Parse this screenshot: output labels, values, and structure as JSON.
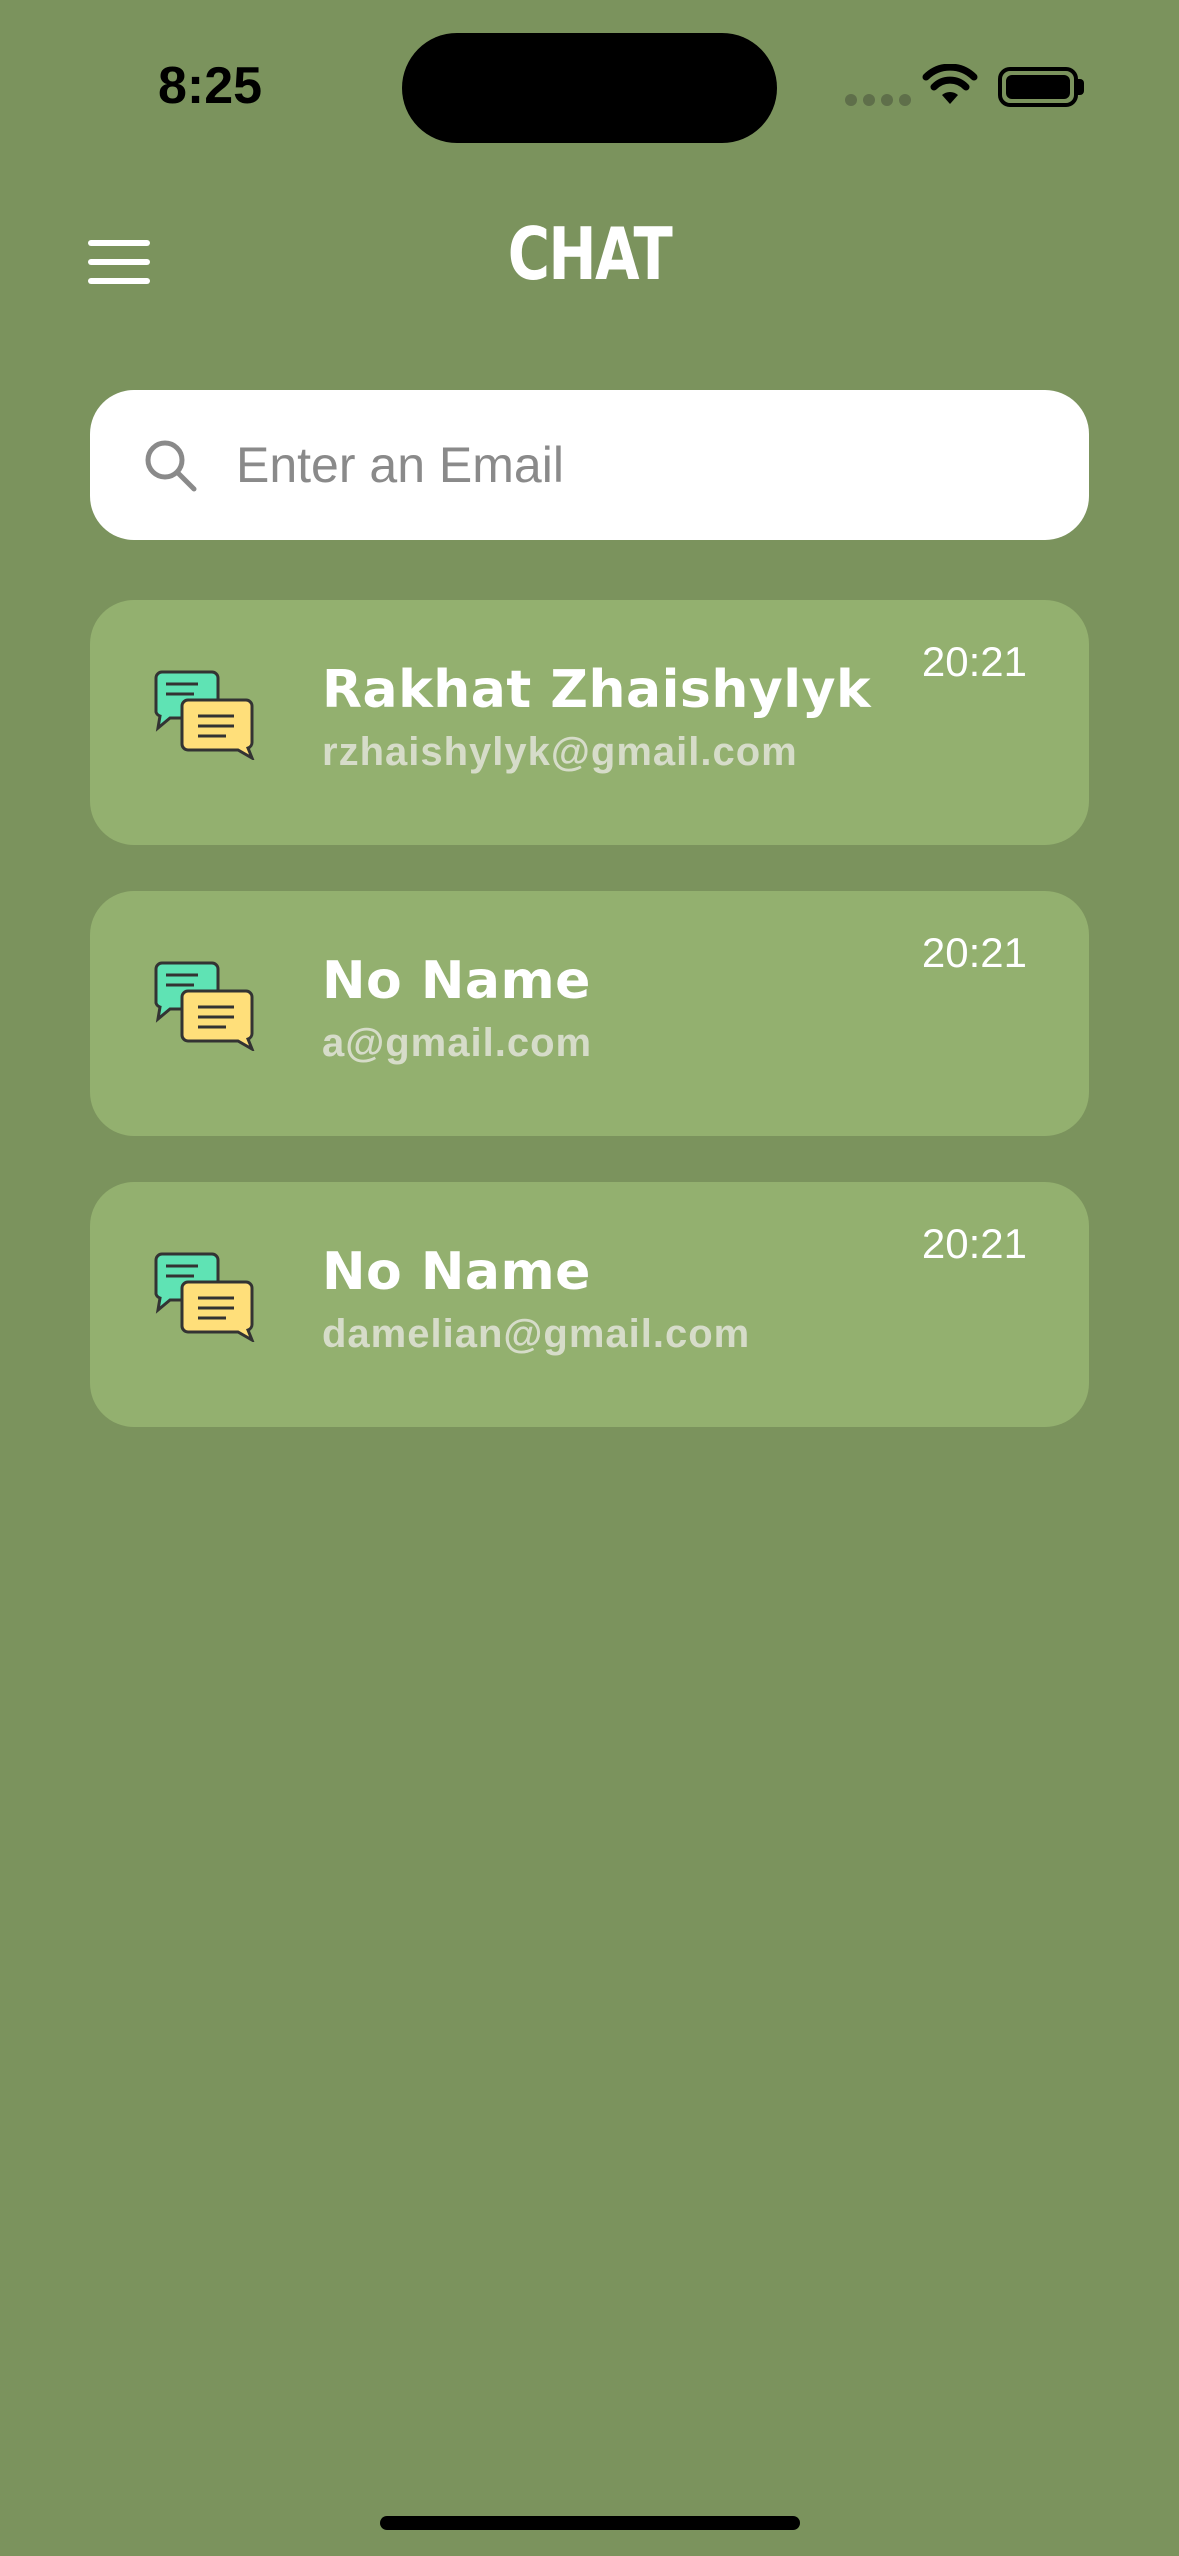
{
  "status_bar": {
    "time": "8:25"
  },
  "header": {
    "title": "CHAT",
    "menu_icon": "hamburger-menu-icon"
  },
  "search": {
    "placeholder": "Enter an Email",
    "value": "",
    "icon": "search-icon"
  },
  "chats": [
    {
      "name": "Rakhat Zhaishylyk",
      "email": "rzhaishylyk@gmail.com",
      "time": "20:21",
      "icon": "chat-bubbles-icon"
    },
    {
      "name": "No Name",
      "email": "a@gmail.com",
      "time": "20:21",
      "icon": "chat-bubbles-icon"
    },
    {
      "name": "No Name",
      "email": "damelian@gmail.com",
      "time": "20:21",
      "icon": "chat-bubbles-icon"
    }
  ],
  "colors": {
    "background": "#7b935d",
    "card": "#93b06f",
    "bubble_back": "#5fe3b4",
    "bubble_front": "#ffdf7a"
  }
}
